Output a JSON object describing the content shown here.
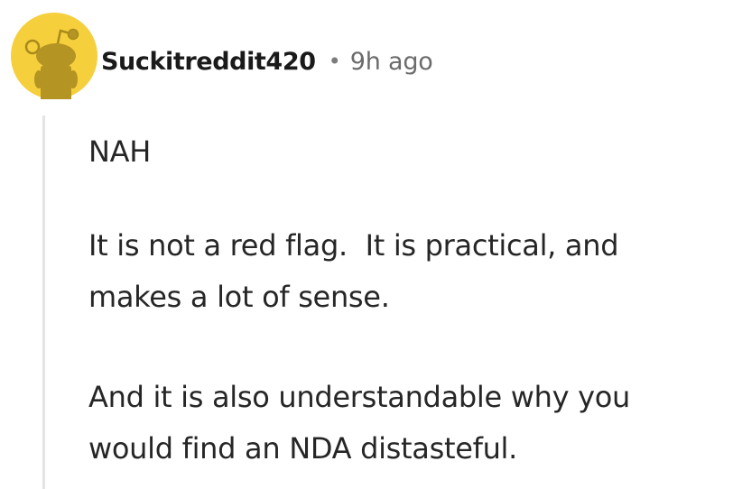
{
  "comment": {
    "username": "Suckitreddit420",
    "separator": "•",
    "timestamp": "9h ago",
    "avatar_icon": "snoo-avatar-icon",
    "avatar_color": "#f5cf3c",
    "paragraphs": [
      "NAH",
      "It is not a red flag.  It is practical, and makes a lot of sense.",
      "And it is also understandable why you would find an NDA distasteful."
    ]
  }
}
